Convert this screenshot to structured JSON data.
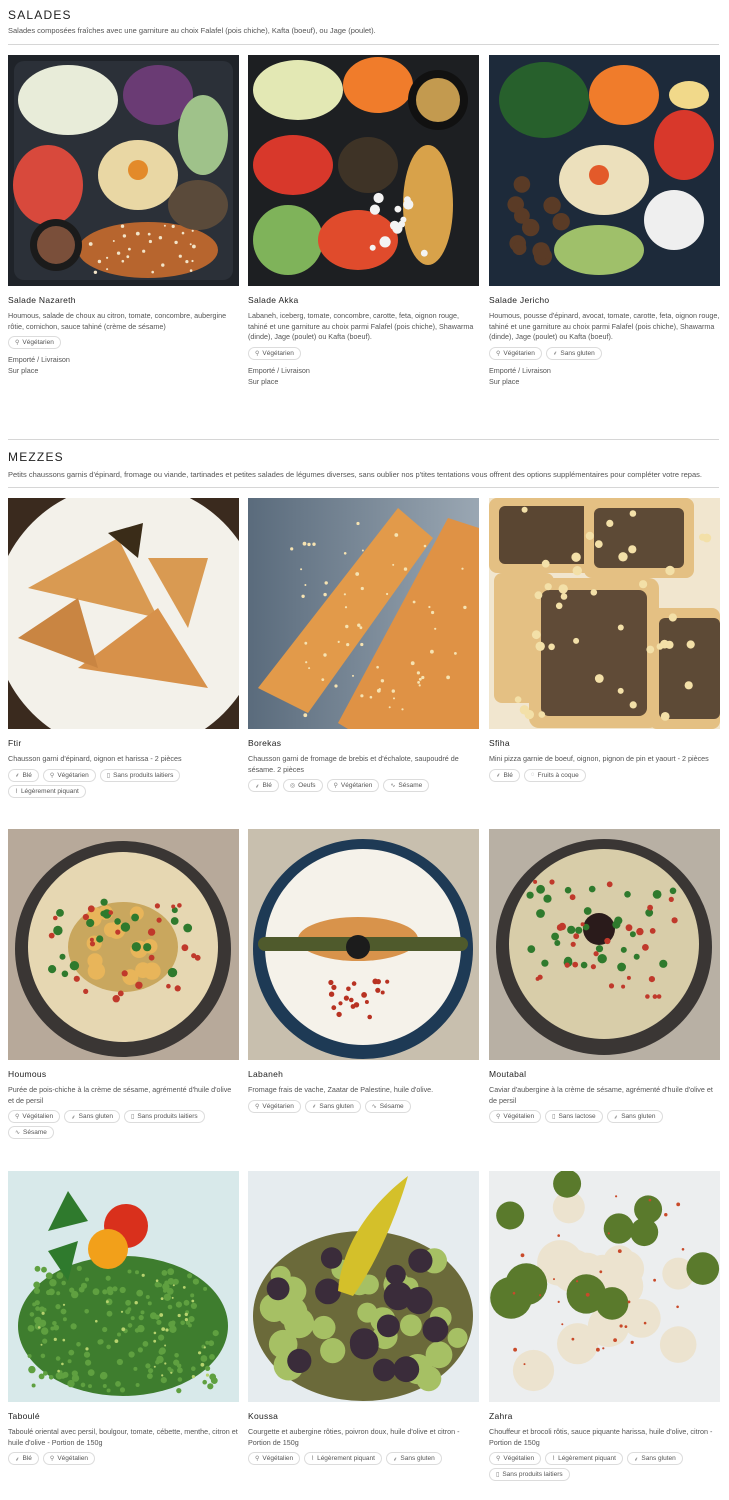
{
  "salades": {
    "title": "SALADES",
    "description": "Salades composées fraîches avec une garniture au choix Falafel (pois chiche), Kafta (boeuf), ou Jage (poulet).",
    "items": [
      {
        "name": "Salade Nazareth",
        "description": "Houmous, salade de choux au citron, tomate, concombre, aubergine rôtie, cornichon, sauce tahiné (crème de sésame)",
        "tags": [
          {
            "icon": "leaf-icon",
            "label": "Végétarien"
          }
        ],
        "availability": [
          "Emporté / Livraison",
          "Sur place"
        ]
      },
      {
        "name": "Salade Akka",
        "description": "Labaneh, iceberg, tomate, concombre, carotte, feta, oignon rouge, tahiné et une garniture au choix parmi Falafel (pois chiche), Shawarma (dinde), Jage (poulet) ou Kafta (boeuf).",
        "tags": [
          {
            "icon": "leaf-icon",
            "label": "Végétarien"
          }
        ],
        "availability": [
          "Emporté / Livraison",
          "Sur place"
        ]
      },
      {
        "name": "Salade Jericho",
        "description": "Houmous, pousse d'épinard, avocat, tomate, carotte, feta, oignon rouge, tahiné et une garniture au choix parmi Falafel (pois chiche), Shawarma (dinde), Jage (poulet) ou Kafta (boeuf).",
        "tags": [
          {
            "icon": "leaf-icon",
            "label": "Végétarien"
          },
          {
            "icon": "wheat-icon",
            "label": "Sans gluten"
          }
        ],
        "availability": [
          "Emporté / Livraison",
          "Sur place"
        ]
      }
    ]
  },
  "mezzes": {
    "title": "MEZZES",
    "description": "Petits chaussons garnis d'épinard, fromage ou viande, tartinades et petites salades de légumes diverses, sans oublier nos p'tites tentations vous offrent des options supplémentaires pour compléter votre repas.",
    "items": [
      {
        "name": "Ftir",
        "description": "Chausson garni d'épinard, oignon et harissa - 2 pièces",
        "tags": [
          {
            "icon": "wheat-icon",
            "label": "Blé"
          },
          {
            "icon": "leaf-icon",
            "label": "Végétarien"
          },
          {
            "icon": "milk-icon",
            "label": "Sans produits laitiers"
          },
          {
            "icon": "pepper-icon",
            "label": "Légèrement piquant"
          }
        ]
      },
      {
        "name": "Borekas",
        "description": "Chausson garni de fromage de brebis et d'échalote, saupoudré de sésame. 2 pièces",
        "tags": [
          {
            "icon": "wheat-icon",
            "label": "Blé"
          },
          {
            "icon": "egg-icon",
            "label": "Oeufs"
          },
          {
            "icon": "leaf-icon",
            "label": "Végétarien"
          },
          {
            "icon": "sesame-icon",
            "label": "Sésame"
          }
        ]
      },
      {
        "name": "Sfiha",
        "description": "Mini pizza garnie de boeuf, oignon, pignon de pin et yaourt - 2 pièces",
        "tags": [
          {
            "icon": "wheat-icon",
            "label": "Blé"
          },
          {
            "icon": "nut-icon",
            "label": "Fruits à coque"
          }
        ]
      },
      {
        "name": "Houmous",
        "description": "Purée de pois-chiche à la crème de sésame, agrémenté d'huile d'olive et de persil",
        "tags": [
          {
            "icon": "leaf-icon",
            "label": "Végétalien"
          },
          {
            "icon": "wheat-icon",
            "label": "Sans gluten"
          },
          {
            "icon": "milk-icon",
            "label": "Sans produits laitiers"
          },
          {
            "icon": "sesame-icon",
            "label": "Sésame"
          }
        ]
      },
      {
        "name": "Labaneh",
        "description": "Fromage frais de vache, Zaatar de Palestine, huile d'olive.",
        "tags": [
          {
            "icon": "leaf-icon",
            "label": "Végétarien"
          },
          {
            "icon": "wheat-icon",
            "label": "Sans gluten"
          },
          {
            "icon": "sesame-icon",
            "label": "Sésame"
          }
        ]
      },
      {
        "name": "Moutabal",
        "description": "Caviar d'aubergine à la crème de sésame, agrémenté d'huile d'olive et de persil",
        "tags": [
          {
            "icon": "leaf-icon",
            "label": "Végétalien"
          },
          {
            "icon": "milk-icon",
            "label": "Sans lactose"
          },
          {
            "icon": "wheat-icon",
            "label": "Sans gluten"
          }
        ]
      },
      {
        "name": "Taboulé",
        "description": "Taboulé oriental avec persil, boulgour, tomate, cébette, menthe, citron et huile d'olive - Portion de 150g",
        "tags": [
          {
            "icon": "wheat-icon",
            "label": "Blé"
          },
          {
            "icon": "leaf-icon",
            "label": "Végétalien"
          }
        ]
      },
      {
        "name": "Koussa",
        "description": "Courgette et aubergine rôties, poivron doux, huile d'olive et citron - Portion de 150g",
        "tags": [
          {
            "icon": "leaf-icon",
            "label": "Végétalien"
          },
          {
            "icon": "pepper-icon",
            "label": "Légèrement piquant"
          },
          {
            "icon": "wheat-icon",
            "label": "Sans gluten"
          }
        ]
      },
      {
        "name": "Zahra",
        "description": "Chouffeur et brocoli rôtis, sauce piquante harissa, huile d'olive, citron - Portion de 150g",
        "tags": [
          {
            "icon": "leaf-icon",
            "label": "Végétalien"
          },
          {
            "icon": "pepper-icon",
            "label": "Légèrement piquant"
          },
          {
            "icon": "wheat-icon",
            "label": "Sans gluten"
          },
          {
            "icon": "milk-icon",
            "label": "Sans produits laitiers"
          }
        ]
      }
    ]
  },
  "icons": {
    "leaf-icon": "⚲",
    "wheat-icon": "⸙",
    "milk-icon": "▯",
    "pepper-icon": "⌇",
    "egg-icon": "◎",
    "sesame-icon": "∿",
    "nut-icon": "◌"
  },
  "colors": {
    "rule": "#d6d6d6",
    "tag_border": "#dcdcdc",
    "text": "#555555"
  }
}
